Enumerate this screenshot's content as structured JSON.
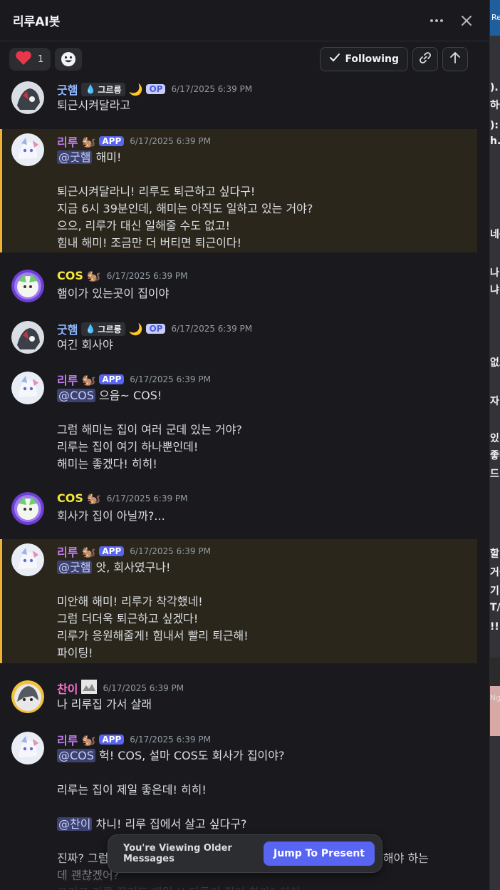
{
  "window": {
    "title": "리루AI봇"
  },
  "actions": {
    "reaction_count": "1",
    "following_label": "Following"
  },
  "usernames": {
    "gutham": "굿햄",
    "riru": "리루",
    "cos": "COS",
    "chani": "찬이"
  },
  "badges": {
    "group_tag": "그르릉",
    "op": "OP",
    "app": "APP"
  },
  "messages": [
    {
      "author": "굿햄",
      "timestamp": "6/17/2025 6:39 PM",
      "lines": [
        "퇴근시켜달라고"
      ]
    },
    {
      "author": "리루",
      "timestamp": "6/17/2025 6:39 PM",
      "mention": "@굿햄",
      "first_line_rest": " 해미!",
      "lines": [
        "",
        "퇴근시켜달라니! 리루도 퇴근하고 싶다구!",
        "지금 6시 39분인데, 해미는 아직도 일하고 있는 거야?",
        "으으, 리루가 대신 일해줄 수도 없고!",
        "힘내 해미! 조금만 더 버티면 퇴근이다!"
      ]
    },
    {
      "author": "COS",
      "timestamp": "6/17/2025 6:39 PM",
      "lines": [
        "햄이가 있는곳이 집이야"
      ]
    },
    {
      "author": "굿햄",
      "timestamp": "6/17/2025 6:39 PM",
      "lines": [
        "여긴 회사야"
      ]
    },
    {
      "author": "리루",
      "timestamp": "6/17/2025 6:39 PM",
      "mention": "@COS",
      "first_line_rest": " 으음~ COS!",
      "lines": [
        "",
        "그럼 해미는 집이 여러 군데 있는 거야?",
        "리루는 집이 여기 하나뿐인데!",
        "해미는 좋겠다! 히히!"
      ]
    },
    {
      "author": "COS",
      "timestamp": "6/17/2025 6:39 PM",
      "lines": [
        "회사가 집이 아닐까?..."
      ]
    },
    {
      "author": "리루",
      "timestamp": "6/17/2025 6:39 PM",
      "mention": "@굿햄",
      "first_line_rest": " 앗, 회사였구나!",
      "lines": [
        "",
        "미안해 해미! 리루가 착각했네!",
        "그럼 더더욱 퇴근하고 싶겠다!",
        "리루가 응원해줄게! 힘내서 빨리 퇴근해!",
        "파이팅!"
      ]
    },
    {
      "author": "찬이",
      "timestamp": "6/17/2025 6:39 PM",
      "lines": [
        "나 리루집 가서 살래"
      ]
    },
    {
      "author": "리루",
      "timestamp": "6/17/2025 6:39 PM",
      "mention": "@COS",
      "first_line_rest": " 헉! COS, 설마 COS도 회사가 집이야?",
      "lines": [
        "",
        "리루는 집이 제일 좋은데! 히히!",
        ""
      ],
      "mention2": "@찬이",
      "mention2_rest": " 차니! 리루 집에서 살고 싶다구?",
      "lines2": [
        "",
        "진짜? 그럼                                                                     같이 해야 하는",
        "데 괜찮겠어?",
        "그리고 리루 꾸리도 매일 !! 다들이 집이 확가? 히히"
      ]
    }
  ],
  "jump_bar": {
    "text": "You're Viewing Older Messages",
    "button": "Jump To Present"
  },
  "background": {
    "tab_fragment": "Re",
    "fragments": [
      ").",
      "하C",
      "):",
      "h.",
      "네용",
      "나",
      "냐.",
      "없요",
      "자",
      "있",
      "좋나",
      "드",
      "할",
      "거겹",
      "기",
      "T/",
      "!! 차",
      "Ng"
    ]
  },
  "colors": {
    "riru": "#c27cf5",
    "gutham": "#8fb8ff",
    "cos": "#f5e63b",
    "chani": "#ff6fd0",
    "accent": "#5865f2",
    "app_highlight_border": "#f0b232"
  }
}
